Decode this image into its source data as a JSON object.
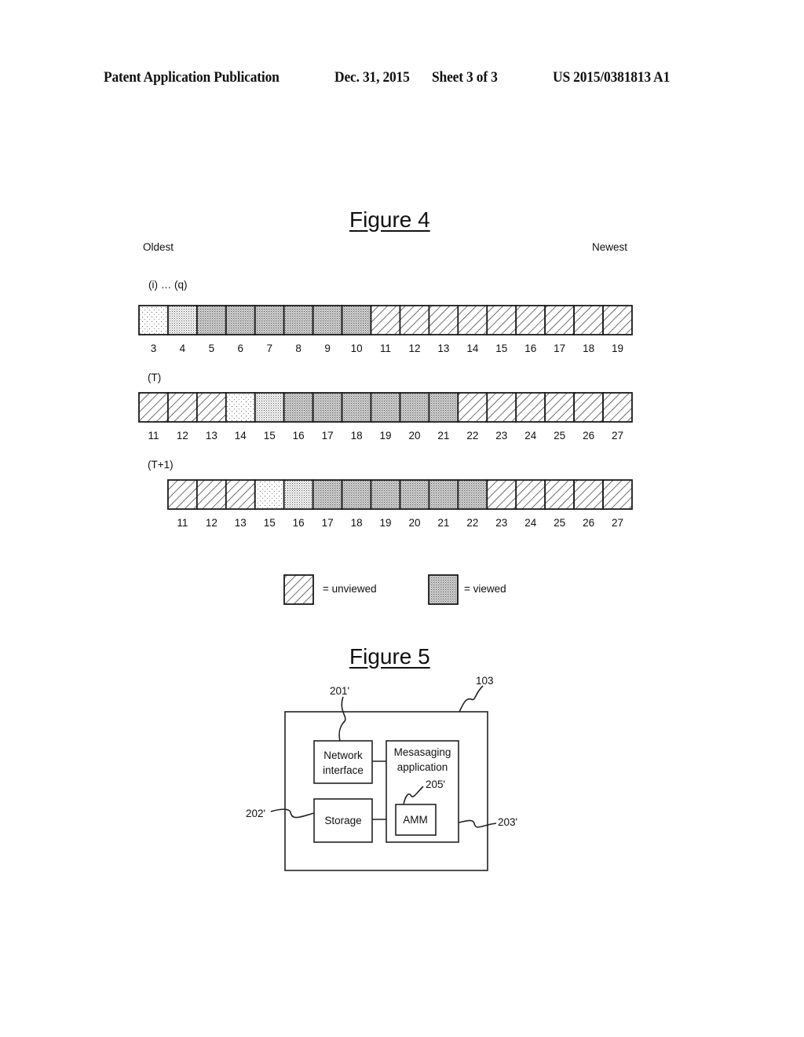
{
  "header": {
    "left": "Patent Application Publication",
    "date": "Dec. 31, 2015",
    "sheet": "Sheet 3 of 3",
    "pub_number": "US 2015/0381813 A1"
  },
  "figure4": {
    "title": "Figure 4",
    "oldest_label": "Oldest",
    "newest_label": "Newest",
    "rows": [
      {
        "label": "(i) … (q)",
        "offset_cells": 0,
        "cells": [
          {
            "n": "3",
            "state": "dots-light"
          },
          {
            "n": "4",
            "state": "dots-medium"
          },
          {
            "n": "5",
            "state": "viewed"
          },
          {
            "n": "6",
            "state": "viewed"
          },
          {
            "n": "7",
            "state": "viewed"
          },
          {
            "n": "8",
            "state": "viewed"
          },
          {
            "n": "9",
            "state": "viewed"
          },
          {
            "n": "10",
            "state": "viewed"
          },
          {
            "n": "11",
            "state": "unviewed"
          },
          {
            "n": "12",
            "state": "unviewed"
          },
          {
            "n": "13",
            "state": "unviewed"
          },
          {
            "n": "14",
            "state": "unviewed"
          },
          {
            "n": "15",
            "state": "unviewed"
          },
          {
            "n": "16",
            "state": "unviewed"
          },
          {
            "n": "17",
            "state": "unviewed"
          },
          {
            "n": "18",
            "state": "unviewed"
          },
          {
            "n": "19",
            "state": "unviewed"
          }
        ]
      },
      {
        "label": "(T)",
        "offset_cells": 0,
        "cells": [
          {
            "n": "11",
            "state": "unviewed"
          },
          {
            "n": "12",
            "state": "unviewed"
          },
          {
            "n": "13",
            "state": "unviewed"
          },
          {
            "n": "14",
            "state": "dots-light"
          },
          {
            "n": "15",
            "state": "dots-medium"
          },
          {
            "n": "16",
            "state": "viewed"
          },
          {
            "n": "17",
            "state": "viewed"
          },
          {
            "n": "18",
            "state": "viewed"
          },
          {
            "n": "19",
            "state": "viewed"
          },
          {
            "n": "20",
            "state": "viewed"
          },
          {
            "n": "21",
            "state": "viewed"
          },
          {
            "n": "22",
            "state": "unviewed"
          },
          {
            "n": "23",
            "state": "unviewed"
          },
          {
            "n": "24",
            "state": "unviewed"
          },
          {
            "n": "25",
            "state": "unviewed"
          },
          {
            "n": "26",
            "state": "unviewed"
          },
          {
            "n": "27",
            "state": "unviewed"
          }
        ]
      },
      {
        "label": "(T+1)",
        "offset_cells": 1,
        "cells": [
          {
            "n": "11",
            "state": "unviewed"
          },
          {
            "n": "12",
            "state": "unviewed"
          },
          {
            "n": "13",
            "state": "unviewed"
          },
          {
            "n": "15",
            "state": "dots-light"
          },
          {
            "n": "16",
            "state": "dots-medium"
          },
          {
            "n": "17",
            "state": "viewed"
          },
          {
            "n": "18",
            "state": "viewed"
          },
          {
            "n": "19",
            "state": "viewed"
          },
          {
            "n": "20",
            "state": "viewed"
          },
          {
            "n": "21",
            "state": "viewed"
          },
          {
            "n": "22",
            "state": "viewed"
          },
          {
            "n": "23",
            "state": "unviewed"
          },
          {
            "n": "24",
            "state": "unviewed"
          },
          {
            "n": "25",
            "state": "unviewed"
          },
          {
            "n": "26",
            "state": "unviewed"
          },
          {
            "n": "27",
            "state": "unviewed"
          }
        ]
      }
    ],
    "legend": [
      {
        "state": "unviewed",
        "text": "= unviewed"
      },
      {
        "state": "viewed",
        "text": "= viewed"
      }
    ]
  },
  "figure5": {
    "title": "Figure 5",
    "refs": {
      "device": "103",
      "network": "201'",
      "storage": "202'",
      "app": "203'",
      "amm": "205'"
    },
    "boxes": {
      "network_line1": "Network",
      "network_line2": "interface",
      "storage": "Storage",
      "app_line1": "Mesasaging",
      "app_line2": "application",
      "amm": "AMM"
    }
  }
}
